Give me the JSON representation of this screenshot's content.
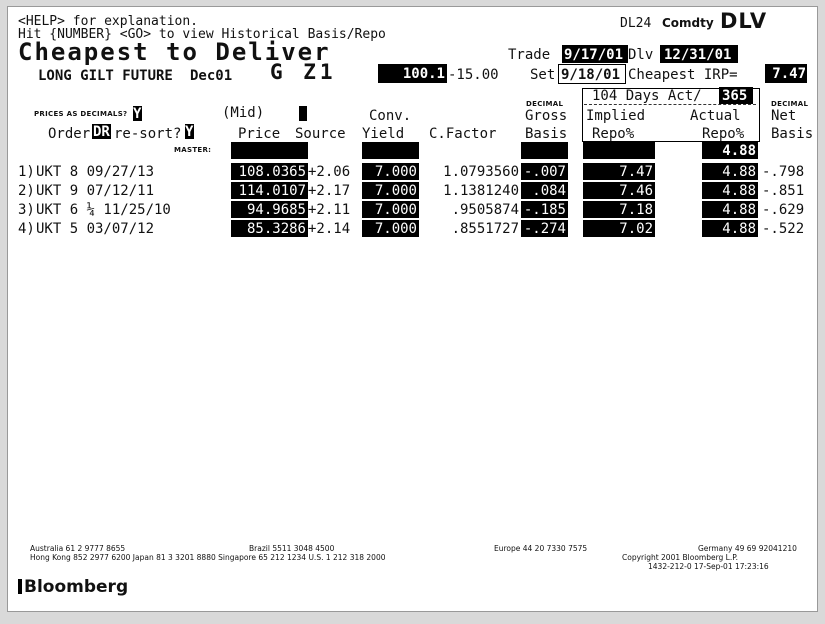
{
  "header": {
    "help_line": "<HELP> for explanation.",
    "hint_line": "Hit {NUMBER} <GO> to view Historical Basis/Repo",
    "ticker": "DL24",
    "sector": "Comdty",
    "function": "DLV",
    "title": "Cheapest to Deliver",
    "future_name": "LONG GILT FUTURE",
    "contract": "Dec01",
    "future_code": "G Z1",
    "future_price": "100.1",
    "future_change": "-15.00",
    "trade_label": "Trade",
    "trade_date": "9/17/01",
    "dlv_label": "Dlv",
    "dlv_date": "12/31/01",
    "settle_label": "Set",
    "settle_date": "9/18/01",
    "cheapest_label": "Cheapest IRP=",
    "cheapest_irp": "7.47",
    "days_label": "104 Days Act/",
    "day_count": "365"
  },
  "controls": {
    "prices_label": "PRICES AS DECIMALS?",
    "prices_value": "Y",
    "mid_label": "(Mid)",
    "order_label": "Order",
    "order_value": "DR",
    "resort_label": "re-sort?",
    "resort_value": "Y",
    "master_label": "MASTER:",
    "master_actual_repo": "4.88"
  },
  "columns": {
    "price": "Price",
    "source": "Source",
    "conv": "Conv.",
    "yield": "Yield",
    "cfactor": "C.Factor",
    "decimal_gross": "DECIMAL",
    "gross": "Gross",
    "gross_basis": "Basis",
    "implied": "Implied",
    "implied_repo": "Repo%",
    "actual": "Actual",
    "actual_repo": "Repo%",
    "decimal_net": "DECIMAL",
    "net": "Net",
    "net_basis": "Basis"
  },
  "rows": [
    {
      "idx": "1)",
      "bond": "UKT 8 09/27/13",
      "price": "108.0365",
      "source": "+2.06",
      "yield": "7.000",
      "cfactor": "1.0793560",
      "gross": "-.007",
      "implied": "7.47",
      "actual": "4.88",
      "net": "-.798"
    },
    {
      "idx": "2)",
      "bond": "UKT 9 07/12/11",
      "price": "114.0107",
      "source": "+2.17",
      "yield": "7.000",
      "cfactor": "1.1381240",
      "gross": ".084",
      "implied": "7.46",
      "actual": "4.88",
      "net": "-.851"
    },
    {
      "idx": "3)",
      "bond": "UKT 6 ¼ 11/25/10",
      "price": "94.9685",
      "source": "+2.11",
      "yield": "7.000",
      "cfactor": ".9505874",
      "gross": "-.185",
      "implied": "7.18",
      "actual": "4.88",
      "net": "-.629"
    },
    {
      "idx": "4)",
      "bond": "UKT 5 03/07/12",
      "price": "85.3286",
      "source": "+2.14",
      "yield": "7.000",
      "cfactor": ".8551727",
      "gross": "-.274",
      "implied": "7.02",
      "actual": "4.88",
      "net": "-.522"
    }
  ],
  "footer": {
    "line1_left": "Australia 61 2 9777 8655",
    "line1_brazil": "Brazil 5511 3048 4500",
    "line1_europe": "Europe 44 20 7330 7575",
    "line1_germany": "Germany 49 69 92041210",
    "line2_left": "Hong Kong 852 2977 6200 Japan 81 3 3201 8880 Singapore 65 212 1234 U.S. 1 212 318 2000",
    "copyright": "Copyright 2001 Bloomberg L.P.",
    "stamp": "1432-212-0 17-Sep-01 17:23:16",
    "logo": "Bloomberg"
  }
}
